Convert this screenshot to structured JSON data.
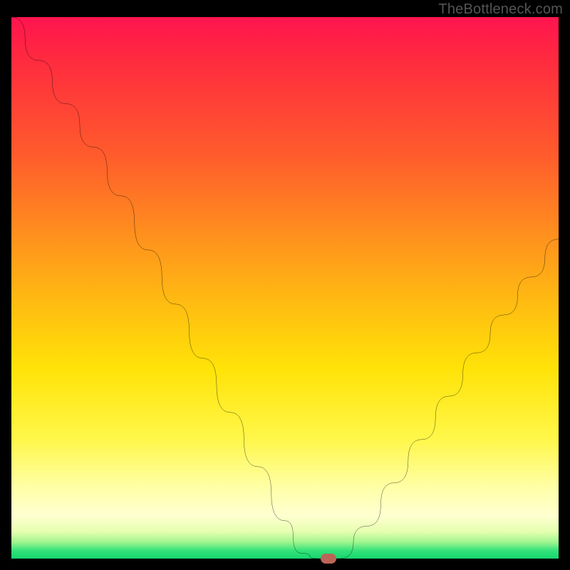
{
  "watermark": "TheBottleneck.com",
  "colors": {
    "curve": "#000000",
    "marker": "#bb6557",
    "frame_bg": "#000000"
  },
  "chart_data": {
    "type": "line",
    "title": "",
    "xlabel": "",
    "ylabel": "",
    "xlim": [
      0,
      100
    ],
    "ylim": [
      0,
      100
    ],
    "grid": false,
    "legend": false,
    "note": "Values estimated from pixel positions; x is normalized horizontal position, y is normalized curve height (0 = bottom green band, 100 = top).",
    "series": [
      {
        "name": "bottleneck-curve",
        "x": [
          0,
          5,
          10,
          15,
          20,
          25,
          30,
          35,
          40,
          45,
          50,
          53,
          56,
          60,
          65,
          70,
          75,
          80,
          85,
          90,
          95,
          100
        ],
        "y": [
          100,
          92,
          84,
          76,
          67,
          57,
          47,
          37,
          27,
          17,
          7,
          1,
          0,
          0,
          6,
          14,
          22,
          30,
          38,
          45,
          52,
          59
        ]
      }
    ],
    "marker": {
      "x": 58,
      "y": 0
    },
    "background_gradient": {
      "orientation": "vertical",
      "stops": [
        {
          "pos": 0.0,
          "color": "#ff144f"
        },
        {
          "pos": 0.25,
          "color": "#ff5a2c"
        },
        {
          "pos": 0.52,
          "color": "#ffb912"
        },
        {
          "pos": 0.78,
          "color": "#fff74a"
        },
        {
          "pos": 0.92,
          "color": "#ffffd0"
        },
        {
          "pos": 0.97,
          "color": "#9ef58e"
        },
        {
          "pos": 1.0,
          "color": "#17d66e"
        }
      ]
    }
  }
}
